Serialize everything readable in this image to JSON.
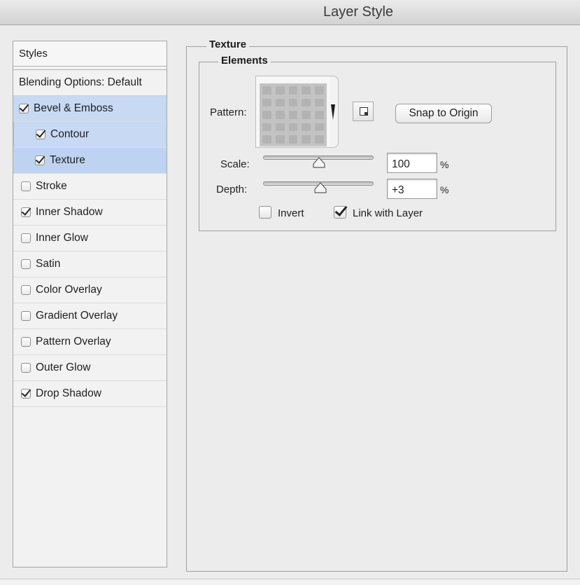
{
  "window": {
    "title": "Layer Style"
  },
  "styles_panel": {
    "header": "Styles",
    "blending_options": "Blending Options: Default",
    "items": [
      {
        "label": "Bevel & Emboss",
        "checked": true,
        "selected": true,
        "indent": false
      },
      {
        "label": "Contour",
        "checked": true,
        "selected": true,
        "indent": true
      },
      {
        "label": "Texture",
        "checked": true,
        "selected": true,
        "indent": true
      },
      {
        "label": "Stroke",
        "checked": false,
        "selected": false,
        "indent": false
      },
      {
        "label": "Inner Shadow",
        "checked": true,
        "selected": false,
        "indent": false
      },
      {
        "label": "Inner Glow",
        "checked": false,
        "selected": false,
        "indent": false
      },
      {
        "label": "Satin",
        "checked": false,
        "selected": false,
        "indent": false
      },
      {
        "label": "Color Overlay",
        "checked": false,
        "selected": false,
        "indent": false
      },
      {
        "label": "Gradient Overlay",
        "checked": false,
        "selected": false,
        "indent": false
      },
      {
        "label": "Pattern Overlay",
        "checked": false,
        "selected": false,
        "indent": false
      },
      {
        "label": "Outer Glow",
        "checked": false,
        "selected": false,
        "indent": false
      },
      {
        "label": "Drop Shadow",
        "checked": true,
        "selected": false,
        "indent": false
      }
    ]
  },
  "texture": {
    "group_title": "Texture",
    "elements_title": "Elements",
    "pattern_label": "Pattern:",
    "snap_button": "Snap to Origin",
    "scale_label": "Scale:",
    "scale_value": "100",
    "scale_unit": "%",
    "scale_level": 0.5,
    "depth_label": "Depth:",
    "depth_value": "+3",
    "depth_unit": "%",
    "depth_level": 0.5,
    "invert_label": "Invert",
    "invert_checked": false,
    "link_label": "Link with Layer",
    "link_checked": true
  },
  "icons": [
    "pattern-swatch-icon",
    "dropdown-arrow-icon",
    "new-preset-icon",
    "checkbox-icon"
  ]
}
